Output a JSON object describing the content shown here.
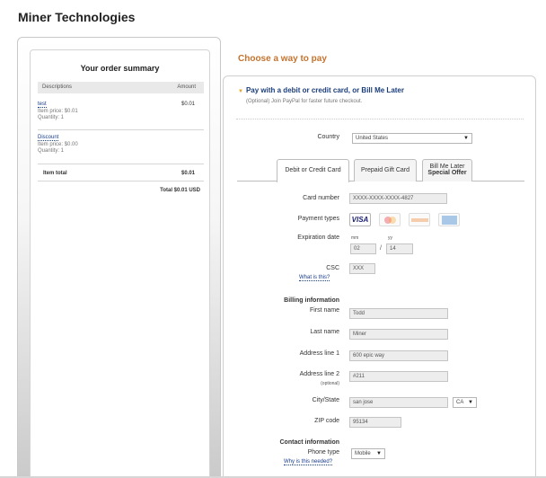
{
  "merchant": {
    "name": "Miner Technologies"
  },
  "summary": {
    "title": "Your order summary",
    "col_description": "Descriptions",
    "col_amount": "Amount",
    "items": [
      {
        "name": "test",
        "price": "Item price: $0.01",
        "quantity": "Quantity: 1",
        "amount": "$0.01"
      },
      {
        "name": "Discount",
        "price": "Item price: $0.00",
        "quantity": "Quantity: 1",
        "amount": ""
      }
    ],
    "item_total_label": "Item total",
    "item_total_value": "$0.01",
    "grand_total": "Total $0.01 USD"
  },
  "payment": {
    "heading": "Choose a way to pay",
    "method_title": "Pay with a debit or credit card, or Bill Me Later",
    "method_subtitle": "(Optional) Join PayPal for faster future checkout.",
    "country_label": "Country",
    "country_value": "United States",
    "tabs": [
      {
        "line1": "Debit or Credit Card",
        "line2": ""
      },
      {
        "line1": "Prepaid Gift Card",
        "line2": ""
      },
      {
        "line1": "Bill Me Later",
        "line2": "Special Offer"
      }
    ],
    "card_number_label": "Card number",
    "card_number_value": "XXXX-XXXX-XXXX-4827",
    "payment_types_label": "Payment types",
    "payment_types": {
      "visa": "VISA"
    },
    "expiration_label": "Expiration date",
    "exp_mm_label": "mm",
    "exp_yy_label": "yy",
    "exp_mm_value": "02",
    "exp_sep": "/",
    "exp_yy_value": "14",
    "csc_label": "CSC",
    "csc_value": "XXX",
    "csc_help": "What is this?"
  },
  "billing": {
    "heading": "Billing information",
    "first_name_label": "First name",
    "first_name_value": "Todd",
    "last_name_label": "Last name",
    "last_name_value": "Miner",
    "address1_label": "Address line 1",
    "address1_value": "600 epic way",
    "address2_label": "Address line 2",
    "address2_optional": "(optional)",
    "address2_value": "#211",
    "city_state_label": "City/State",
    "city_value": "san jose",
    "state_value": "CA",
    "zip_label": "ZIP code",
    "zip_value": "95134"
  },
  "contact": {
    "heading": "Contact information",
    "phone_type_label": "Phone type",
    "phone_help": "Why is this needed?",
    "phone_type_value": "Mobile"
  }
}
